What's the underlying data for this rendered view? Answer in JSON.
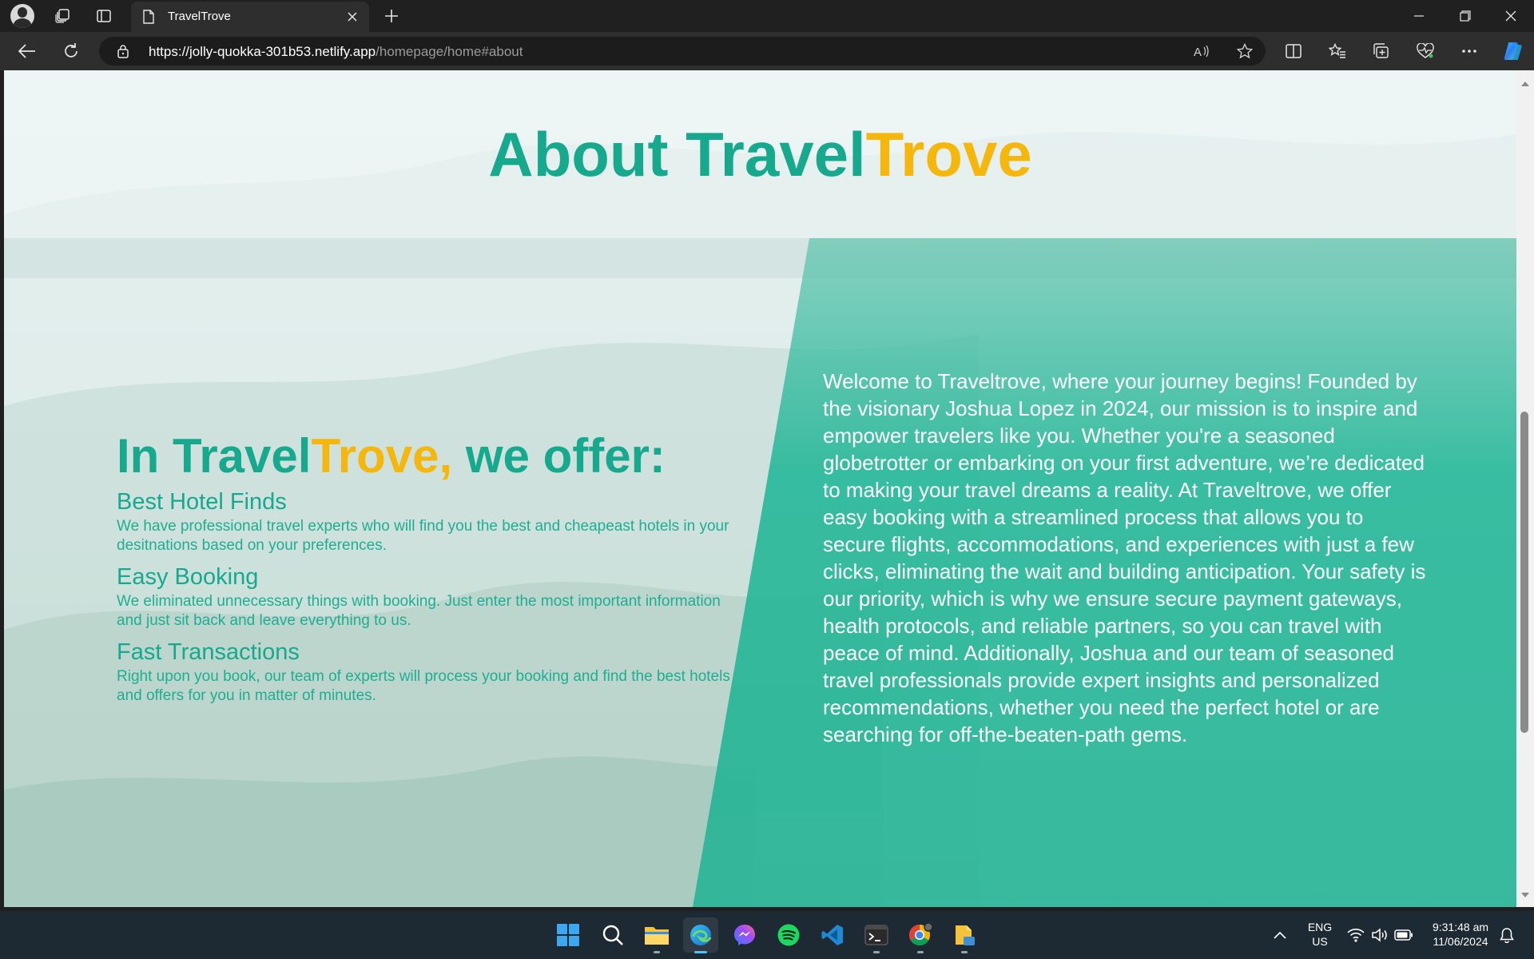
{
  "browser": {
    "tab_title": "TravelTrove",
    "url_host": "https://jolly-quokka-301b53.netlify.app",
    "url_path": "/homepage/home#about"
  },
  "page": {
    "about_title_main": "About Travel",
    "about_title_accent": "Trove",
    "offer_heading_prefix": "In Travel",
    "offer_heading_accent": "Trove,",
    "offer_heading_suffix": " we offer:",
    "features": [
      {
        "title": "Best Hotel Finds",
        "desc": "We have professional travel experts who will find you the best and cheapeast hotels in your desitnations based on your preferences."
      },
      {
        "title": "Easy Booking",
        "desc": "We eliminated unnecessary things with booking. Just enter the most important information and just sit back and leave everything to us."
      },
      {
        "title": "Fast Transactions",
        "desc": "Right upon you book, our team of experts will process your booking and find the best hotels and offers for you in matter of minutes."
      }
    ],
    "welcome_text": "Welcome to Traveltrove, where your journey begins! Founded by the visionary Joshua Lopez in 2024, our mission is to inspire and empower travelers like you. Whether you're a seasoned globetrotter or embarking on your first adventure, we’re dedicated to making your travel dreams a reality. At Traveltrove, we offer easy booking with a streamlined process that allows you to secure flights, accommodations, and experiences with just a few clicks, eliminating the wait and building anticipation. Your safety is our priority, which is why we ensure secure payment gateways, health protocols, and reliable partners, so you can travel with peace of mind. Additionally, Joshua and our team of seasoned travel professionals provide expert insights and personalized recommendations, whether you need the perfect hotel or are searching for off-the-beaten-path gems."
  },
  "colors": {
    "brand_teal": "#16a98e",
    "brand_yellow": "#f6b70c"
  },
  "taskbar": {
    "language": "ENG",
    "region": "US",
    "time": "9:31:48 am",
    "date": "11/06/2024",
    "apps": [
      "start-icon",
      "search-icon",
      "file-explorer-icon",
      "edge-icon",
      "messenger-icon",
      "spotify-icon",
      "vscode-icon",
      "terminal-icon",
      "chrome-icon",
      "notes-icon"
    ]
  }
}
